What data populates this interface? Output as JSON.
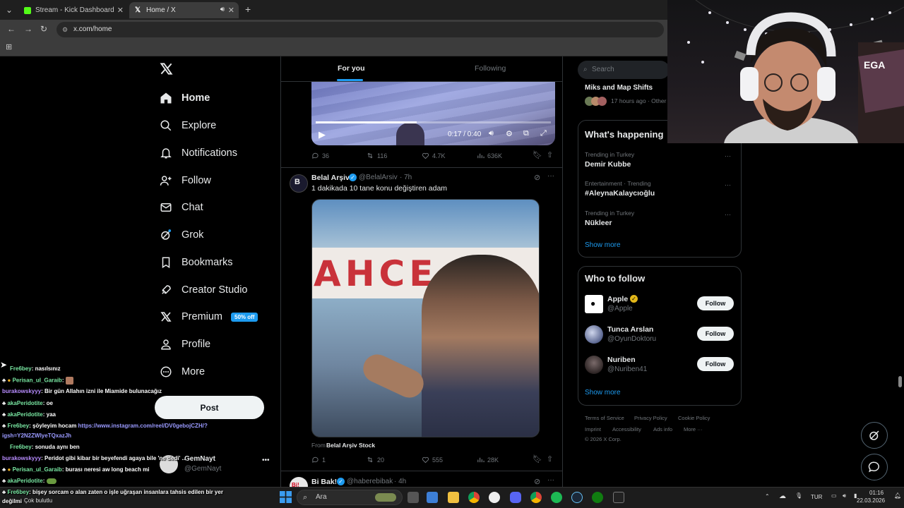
{
  "browser": {
    "tabs": [
      {
        "title": "Stream - Kick Dashboard",
        "active": false
      },
      {
        "title": "Home / X",
        "active": true
      }
    ],
    "url": "x.com/home"
  },
  "nav": {
    "items": [
      {
        "label": "Home",
        "icon": "home-icon"
      },
      {
        "label": "Explore",
        "icon": "search-icon"
      },
      {
        "label": "Notifications",
        "icon": "bell-icon"
      },
      {
        "label": "Follow",
        "icon": "person-plus-icon"
      },
      {
        "label": "Chat",
        "icon": "mail-icon"
      },
      {
        "label": "Grok",
        "icon": "grok-icon"
      },
      {
        "label": "Bookmarks",
        "icon": "bookmark-icon"
      },
      {
        "label": "Creator Studio",
        "icon": "rocket-icon"
      },
      {
        "label": "Premium",
        "icon": "x-logo-icon"
      },
      {
        "label": "Profile",
        "icon": "person-icon"
      },
      {
        "label": "More",
        "icon": "more-circle-icon"
      }
    ],
    "premium_badge": "50% off",
    "post_label": "Post",
    "account": {
      "name": "GemNayt",
      "handle": "@GemNayt"
    }
  },
  "feed": {
    "tabs": [
      "For you",
      "Following"
    ],
    "video_post": {
      "time": "0:17 / 0:40",
      "video_progress": 0.43,
      "stats": {
        "replies": "36",
        "reposts": "116",
        "likes": "4.7K",
        "views": "636K"
      }
    },
    "post": {
      "author": "Belal Arşiv",
      "handle": "@BelalArsiv",
      "age": "· 7h",
      "text": "1 dakikada 10 tane konu değiştiren adam",
      "media_text": "AHCE",
      "source_prefix": "From",
      "source": "Belal Arşiv Stock",
      "stats": {
        "replies": "1",
        "reposts": "20",
        "likes": "555",
        "views": "28K"
      }
    },
    "next_post": {
      "author": "Bi Bak!",
      "handle": "@haberebibak",
      "age": "· 4h"
    }
  },
  "right": {
    "search_placeholder": "Search",
    "live": {
      "title": "Miks and Map Shifts",
      "meta": "17 hours ago · Other"
    },
    "happening": {
      "title": "What's happening",
      "trends": [
        {
          "meta": "Trending in Turkey",
          "name": "Demir Kubbe"
        },
        {
          "meta": "Entertainment · Trending",
          "name": "#AleynaKalaycıoğlu"
        },
        {
          "meta": "Trending in Turkey",
          "name": "Nükleer"
        }
      ],
      "show_more": "Show more"
    },
    "who_to_follow": {
      "title": "Who to follow",
      "users": [
        {
          "name": "Apple",
          "handle": "@Apple",
          "verified": true
        },
        {
          "name": "Tunca Arslan",
          "handle": "@OyunDoktoru",
          "verified": false
        },
        {
          "name": "Nuriben",
          "handle": "@Nuriben41",
          "verified": false
        }
      ],
      "follow_label": "Follow",
      "show_more": "Show more"
    },
    "footer": [
      "Terms of Service",
      "Privacy Policy",
      "Cookie Policy",
      "Imprint",
      "Accessibility",
      "Ads info",
      "More ···",
      "© 2026 X Corp."
    ]
  },
  "webcam": {
    "banner_text": "EGA"
  },
  "chat": [
    {
      "user": "Fre6bey",
      "msg": ": nasılsınız"
    },
    {
      "user": "Perisan_ul_Garaib",
      "msg": ":"
    },
    {
      "user": "burakowskyyy",
      "msg": ": Bir gün Allahın izni ile Miamide bulunacağız"
    },
    {
      "user": "akaPeridotite",
      "msg": ": oe"
    },
    {
      "user": "akaPeridotite",
      "msg": ": yaa"
    },
    {
      "user": "Fre6bey",
      "msg": ": şöyleyim hocam",
      "link": "https://www.instagram.com/reel/DV0gebojCZH/?",
      "link2": "igsh=Y2N2ZWIyeTQxazJh"
    },
    {
      "user": "Fre6bey",
      "msg": ": sonuda aynı ben"
    },
    {
      "user": "burakowskyyy",
      "msg": ": Peridot gibi kibar bir beyefendi agaya bile 'ne dedi' ..."
    },
    {
      "user": "Perisan_ul_Garaib",
      "msg": ": burası neresi aw long beach mi"
    },
    {
      "user": "akaPeridotite",
      "msg": ":"
    },
    {
      "user": "Fre6bey",
      "msg": ": bişey sorcam o alan zaten o işle uğraşan insanlara tahsis edilen bir yer"
    },
    {
      "user": "",
      "msg": "değilmi"
    }
  ],
  "taskbar": {
    "search_label": "Ara",
    "weather": "Çok bulutlu",
    "language": "TUR",
    "time": "01:16",
    "date": "22.03.2026"
  }
}
